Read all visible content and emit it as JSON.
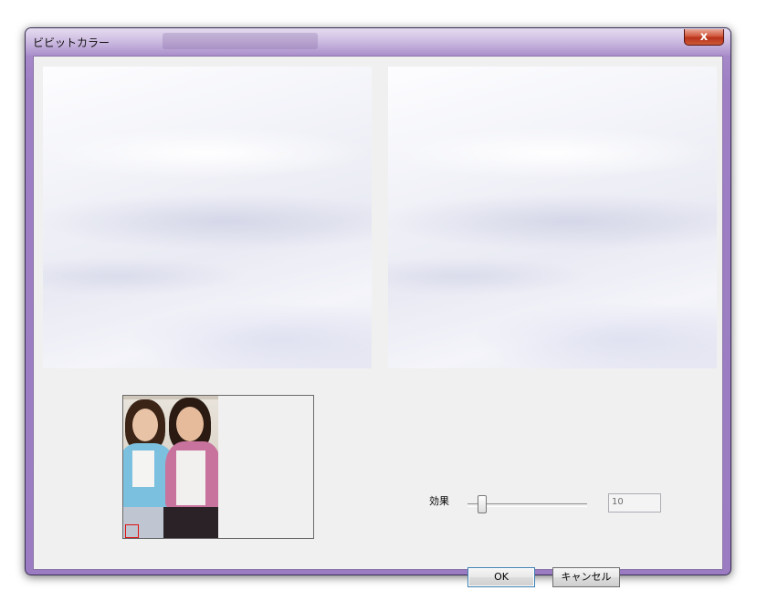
{
  "window": {
    "title": "ビビットカラー",
    "close_glyph": "x"
  },
  "controls": {
    "effect_label": "効果",
    "effect_value": "10",
    "effect_slider_fraction": 0.12,
    "ok_label": "OK",
    "cancel_label": "キャンセル"
  },
  "colors": {
    "selection_rect": "#e01010",
    "frame": "#9b7cc2"
  }
}
